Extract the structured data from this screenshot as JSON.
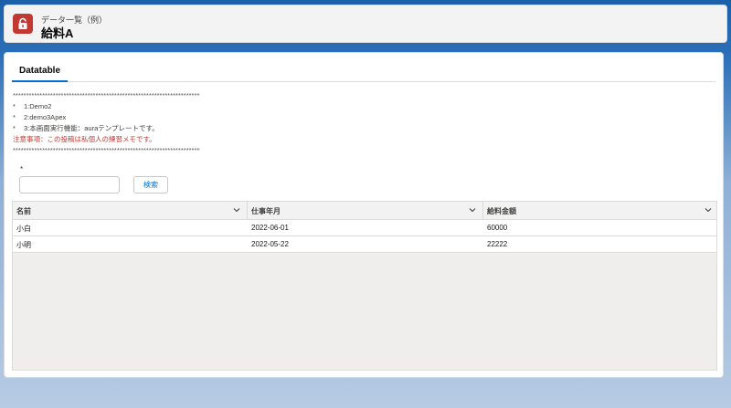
{
  "header": {
    "subtitle": "データ一覧（例）",
    "title": "給料A"
  },
  "tabs": [
    {
      "label": "Datatable",
      "active": true
    }
  ],
  "notes": {
    "separator": "****************************************************************************************",
    "items": [
      "1:Demo2",
      "2:demo3Apex",
      "3:本画面実行機能：auraテンプレートです。"
    ],
    "star": "*",
    "warning": "注意事項：この投稿は私個人の練習メモです。"
  },
  "search": {
    "required_mark": "*",
    "value": "",
    "button_label": "検索"
  },
  "table": {
    "columns": [
      "名前",
      "仕事年月",
      "給料金額"
    ],
    "rows": [
      [
        "小白",
        "2022-06-01",
        "60000"
      ],
      [
        "小明",
        "2022-05-22",
        "22222"
      ]
    ]
  },
  "colors": {
    "accent": "#0070d2",
    "warning": "#c23934",
    "header_icon_bg": "#c23934"
  },
  "icons": {
    "header": "lock-icon",
    "column_menu": "chevron-down-icon"
  }
}
